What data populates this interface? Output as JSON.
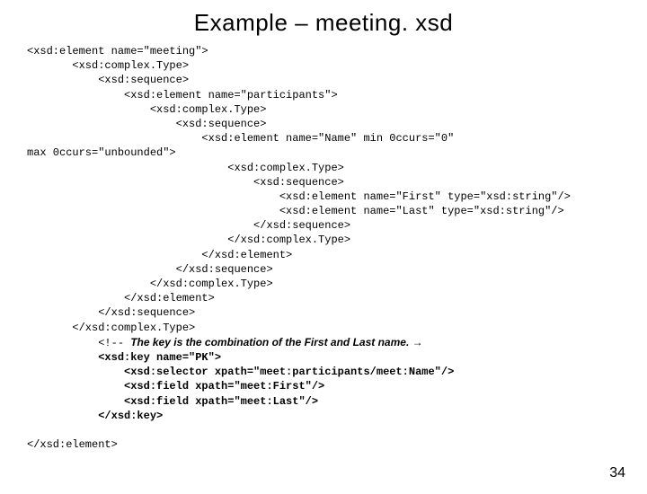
{
  "title": "Example – meeting. xsd",
  "code_lines": [
    "<xsd:element name=\"meeting\">",
    "       <xsd:complex.Type>",
    "           <xsd:sequence>",
    "               <xsd:element name=\"participants\">",
    "                   <xsd:complex.Type>",
    "                       <xsd:sequence>",
    "                           <xsd:element name=\"Name\" min 0ccurs=\"0\"",
    "max 0ccurs=\"unbounded\">",
    "                               <xsd:complex.Type>",
    "                                   <xsd:sequence>",
    "                                       <xsd:element name=\"First\" type=\"xsd:string\"/>",
    "                                       <xsd:element name=\"Last\" type=\"xsd:string\"/>",
    "                                   </xsd:sequence>",
    "                               </xsd:complex.Type>",
    "                           </xsd:element>",
    "                       </xsd:sequence>",
    "                   </xsd:complex.Type>",
    "               </xsd:element>",
    "           </xsd:sequence>",
    "       </xsd:complex.Type>"
  ],
  "comment_prefix": "           <!-- ",
  "comment_text": "The key is the combination of the First and Last name. →",
  "bold_lines": [
    "           <xsd:key name=\"PK\">",
    "               <xsd:selector xpath=\"meet:participants/meet:Name\"/>",
    "               <xsd:field xpath=\"meet:First\"/>",
    "               <xsd:field xpath=\"meet:Last\"/>",
    "           </xsd:key>"
  ],
  "closing_line": "</xsd:element>",
  "page_number": "34"
}
